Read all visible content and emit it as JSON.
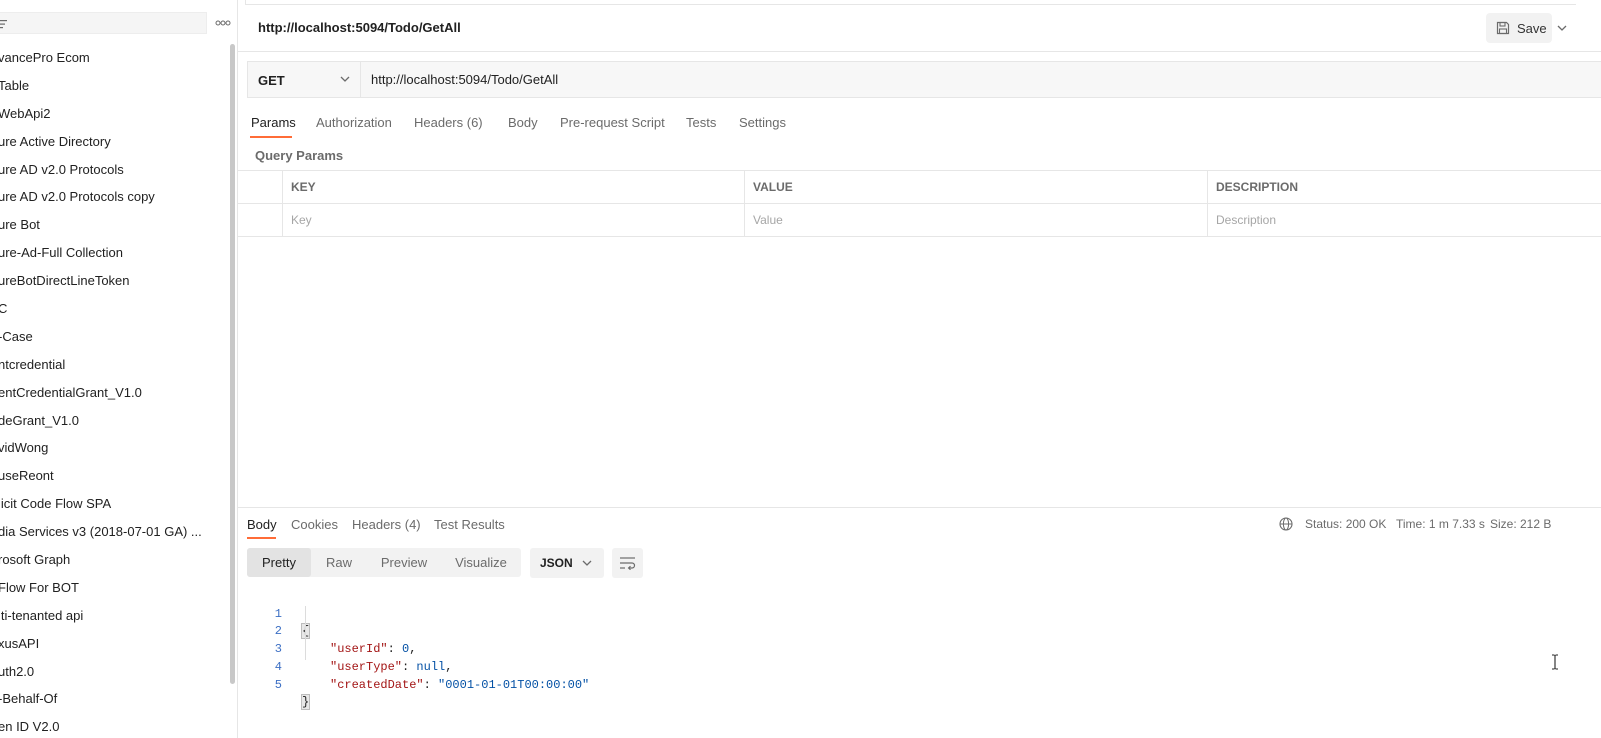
{
  "sidebar": {
    "search_placeholder": "",
    "items": [
      {
        "label": "vancePro Ecom"
      },
      {
        "label": "Table"
      },
      {
        "label": "WebApi2"
      },
      {
        "label": "ure Active Directory"
      },
      {
        "label": "ure AD v2.0 Protocols"
      },
      {
        "label": "ure AD v2.0 Protocols copy"
      },
      {
        "label": "ure Bot"
      },
      {
        "label": "ure-Ad-Full Collection"
      },
      {
        "label": "ureBotDirectLineToken"
      },
      {
        "label": "C"
      },
      {
        "label": "-Case"
      },
      {
        "label": "ntcredential"
      },
      {
        "label": "entCredentialGrant_V1.0"
      },
      {
        "label": "deGrant_V1.0"
      },
      {
        "label": "vidWong"
      },
      {
        "label": "useReont"
      },
      {
        "label": "licit Code Flow SPA"
      },
      {
        "label": "dia Services v3 (2018-07-01 GA) ..."
      },
      {
        "label": "rosoft Graph"
      },
      {
        "label": " Flow For BOT"
      },
      {
        "label": "lti-tenanted api"
      },
      {
        "label": "xusAPI"
      },
      {
        "label": "uth2.0"
      },
      {
        "label": "-Behalf-Of"
      },
      {
        "label": "en ID V2.0"
      }
    ]
  },
  "header": {
    "title": "http://localhost:5094/Todo/GetAll",
    "save_label": "Save"
  },
  "request": {
    "method": "GET",
    "url": "http://localhost:5094/Todo/GetAll",
    "tabs": [
      "Params",
      "Authorization",
      "Headers (6)",
      "Body",
      "Pre-request Script",
      "Tests",
      "Settings"
    ],
    "query_params_label": "Query Params",
    "table": {
      "headers": [
        "KEY",
        "VALUE",
        "DESCRIPTION"
      ],
      "placeholders": [
        "Key",
        "Value",
        "Description"
      ]
    }
  },
  "response": {
    "tabs": [
      "Body",
      "Cookies",
      "Headers (4)",
      "Test Results"
    ],
    "status": "Status: 200 OK",
    "time": "Time: 1 m 7.33 s",
    "size": "Size: 212 B",
    "views": [
      "Pretty",
      "Raw",
      "Preview",
      "Visualize"
    ],
    "format": "JSON",
    "code": {
      "line_numbers": [
        "1",
        "2",
        "3",
        "4",
        "5"
      ],
      "open_brace": "{",
      "close_brace": "}",
      "k1": "\"userId\"",
      "v1": "0",
      "k2": "\"userType\"",
      "v2": "null",
      "k3": "\"createdDate\"",
      "v3": "\"0001-01-01T00:00:00\""
    }
  },
  "colors": {
    "accent": "#ff6c37",
    "json_key": "#a31515",
    "json_value": "#0451a5"
  }
}
